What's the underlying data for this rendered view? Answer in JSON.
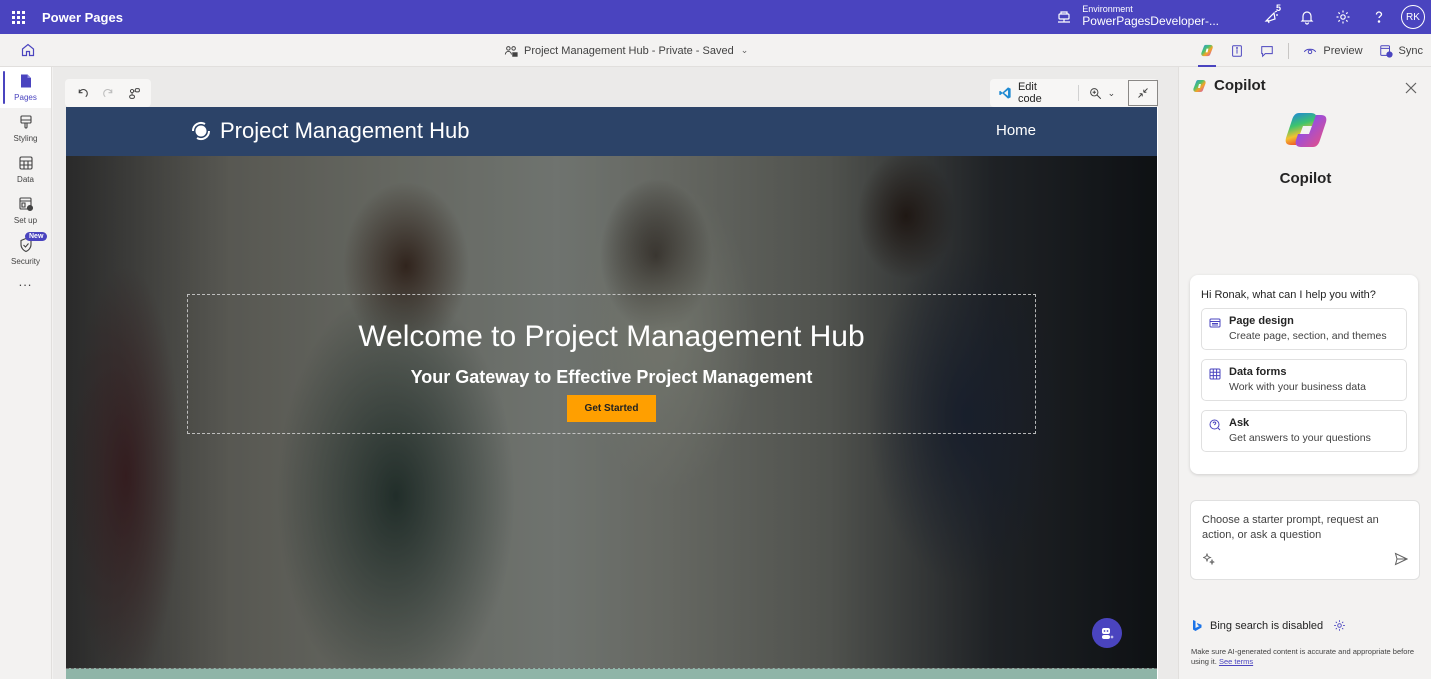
{
  "topbar": {
    "app_title": "Power Pages",
    "environment_label": "Environment",
    "environment_name": "PowerPagesDeveloper-...",
    "notification_count": "5",
    "avatar_initials": "RK",
    "brand_color": "#4a44bf"
  },
  "cmdbar": {
    "site_title": "Project Management Hub - Private - Saved",
    "preview_label": "Preview",
    "sync_label": "Sync"
  },
  "rail": {
    "items": [
      {
        "label": "Pages",
        "icon": "page-icon",
        "active": true
      },
      {
        "label": "Styling",
        "icon": "paintbrush-icon",
        "active": false
      },
      {
        "label": "Data",
        "icon": "table-icon",
        "active": false
      },
      {
        "label": "Set up",
        "icon": "settings-window-icon",
        "active": false
      },
      {
        "label": "Security",
        "icon": "shield-icon",
        "active": false,
        "badge": "New"
      }
    ],
    "more_label": "..."
  },
  "canvas": {
    "edit_code_label": "Edit code"
  },
  "site": {
    "name": "Project Management Hub",
    "nav_home": "Home",
    "header_color": "#2c4368",
    "hero_title": "Welcome to Project Management Hub",
    "hero_subtitle": "Your Gateway to Effective Project Management",
    "cta_label": "Get Started",
    "cta_color": "#ff9f00"
  },
  "copilot": {
    "header_title": "Copilot",
    "big_title": "Copilot",
    "greeting": "Hi Ronak, what can I help you with?",
    "options": [
      {
        "title": "Page design",
        "description": "Create page, section, and themes",
        "icon": "page-design-icon"
      },
      {
        "title": "Data forms",
        "description": "Work with your business data",
        "icon": "grid-icon"
      },
      {
        "title": "Ask",
        "description": "Get answers to your questions",
        "icon": "question-chat-icon"
      }
    ],
    "input_placeholder": "Choose a starter prompt, request an action, or ask a question",
    "input_value": "",
    "bing_status": "Bing search is disabled",
    "disclaimer": "Make sure AI-generated content is accurate and appropriate before using it.",
    "terms_link": "See terms"
  }
}
